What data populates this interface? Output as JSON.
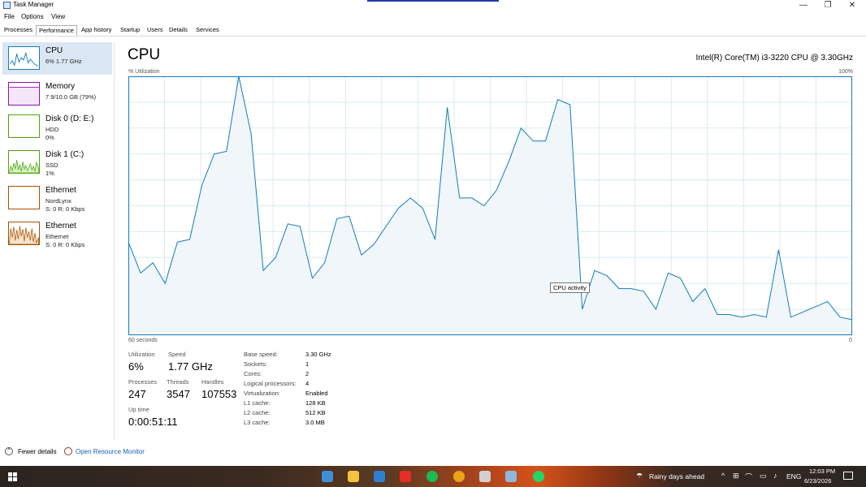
{
  "window": {
    "title": "Task Manager",
    "minimize": "—",
    "maximize": "❐",
    "close": "✕"
  },
  "menu": [
    "File",
    "Options",
    "View"
  ],
  "tabs": [
    "Processes",
    "Performance",
    "App history",
    "Startup",
    "Users",
    "Details",
    "Services"
  ],
  "active_tab": "Performance",
  "sidebar": {
    "items": [
      {
        "name": "CPU",
        "line1": "6%  1.77 GHz",
        "line2": ""
      },
      {
        "name": "Memory",
        "line1": "7.9/10.0 GB (79%)",
        "line2": ""
      },
      {
        "name": "Disk 0 (D: E:)",
        "line1": "HDD",
        "line2": "0%"
      },
      {
        "name": "Disk 1 (C:)",
        "line1": "SSD",
        "line2": "1%"
      },
      {
        "name": "Ethernet",
        "line1": "NordLynx",
        "line2": "S: 0 R: 0 Kbps"
      },
      {
        "name": "Ethernet",
        "line1": "Ethernet",
        "line2": "S: 0 R: 0 Kbps"
      }
    ]
  },
  "main": {
    "title": "CPU",
    "model": "Intel(R) Core(TM) i3-3220 CPU @ 3.30GHz",
    "y_label": "% Utilization",
    "y_max_label": "100%",
    "x_left_label": "60 seconds",
    "x_right_label": "0",
    "tooltip": "CPU activity"
  },
  "chart_data": {
    "type": "area",
    "ylim": [
      0,
      100
    ],
    "grid": true,
    "color": "#117dbb",
    "values": [
      36,
      24,
      28,
      20,
      36,
      37,
      58,
      70,
      71,
      100,
      78,
      25,
      30,
      43,
      42,
      22,
      28,
      45,
      46,
      31,
      35,
      42,
      49,
      53,
      49,
      37,
      88,
      53,
      53,
      50,
      56,
      67,
      80,
      75,
      75,
      91,
      89,
      10,
      25,
      23,
      18,
      18,
      17,
      10,
      24,
      22,
      13,
      18,
      8,
      8,
      7,
      8,
      7,
      33,
      7,
      9,
      11,
      13,
      7,
      6
    ]
  },
  "stats": {
    "utilization_label": "Utilization",
    "utilization": "6%",
    "speed_label": "Speed",
    "speed": "1.77 GHz",
    "processes_label": "Processes",
    "processes": "247",
    "threads_label": "Threads",
    "threads": "3547",
    "handles_label": "Handles",
    "handles": "107553",
    "uptime_label": "Up time",
    "uptime": "0:00:51:11"
  },
  "specs": [
    {
      "label": "Base speed:",
      "value": "3.30 GHz"
    },
    {
      "label": "Sockets:",
      "value": "1"
    },
    {
      "label": "Cores:",
      "value": "2"
    },
    {
      "label": "Logical processors:",
      "value": "4"
    },
    {
      "label": "Virtualization:",
      "value": "Enabled"
    },
    {
      "label": "L1 cache:",
      "value": "128 KB"
    },
    {
      "label": "L2 cache:",
      "value": "512 KB"
    },
    {
      "label": "L3 cache:",
      "value": "3.0 MB"
    }
  ],
  "footer": {
    "fewer_details": "Fewer details",
    "resource_monitor": "Open Resource Monitor"
  },
  "taskbar": {
    "weather": "Rainy days ahead",
    "language": "ENG",
    "time": "12:03 PM",
    "date": "6/23/2026"
  },
  "colors": {
    "cpu_line": "#117dbb",
    "cpu_fill": "#f1f6fa",
    "memory_line": "#8b12ae",
    "disk_line": "#4da60c",
    "ethernet_line": "#a74f01",
    "selected_bg": "#dbe6f4"
  }
}
